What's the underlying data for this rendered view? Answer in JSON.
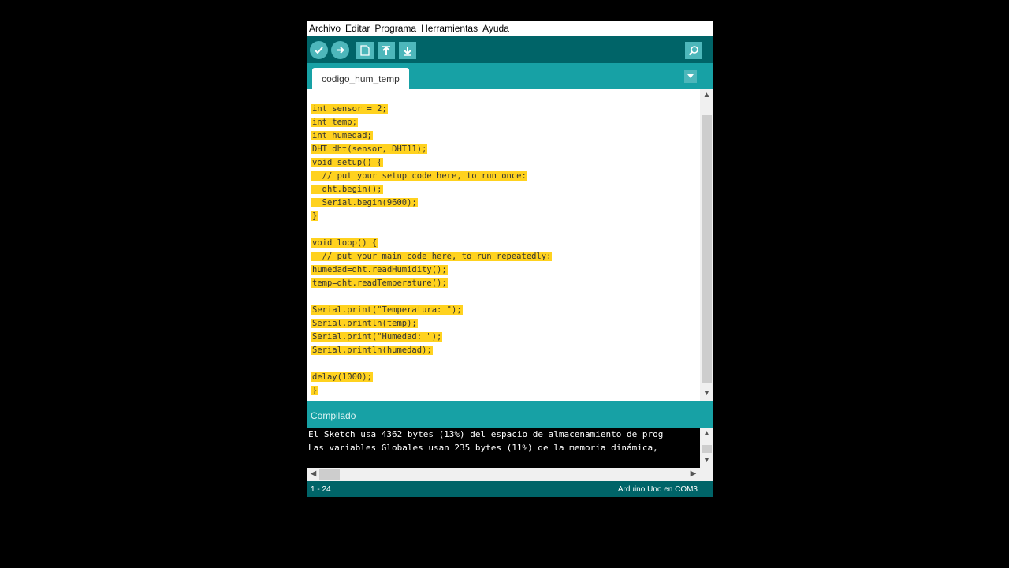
{
  "menu": [
    "Archivo",
    "Editar",
    "Programa",
    "Herramientas",
    "Ayuda"
  ],
  "toolbar": {
    "verify_icon": "check-icon",
    "upload_icon": "arrow-right-icon",
    "new_icon": "new-file-icon",
    "open_icon": "open-up-arrow-icon",
    "save_icon": "save-down-arrow-icon",
    "serial_monitor_icon": "magnifier-icon"
  },
  "tab": {
    "label": "codigo_hum_temp"
  },
  "code": [
    "int sensor = 2;",
    "int temp;",
    "int humedad;",
    "DHT dht(sensor, DHT11);",
    "void setup() {",
    "  // put your setup code here, to run once:",
    "  dht.begin();",
    "  Serial.begin(9600);",
    "}",
    "",
    "void loop() {",
    "  // put your main code here, to run repeatedly:",
    "humedad=dht.readHumidity();",
    "temp=dht.readTemperature();",
    "",
    "Serial.print(\"Temperatura: \");",
    "Serial.println(temp);",
    "Serial.print(\"Humedad: \");",
    "Serial.println(humedad);",
    "",
    "delay(1000);",
    "}"
  ],
  "status": {
    "label": "Compilado"
  },
  "console": [
    "El Sketch usa 4362 bytes (13%) del espacio de almacenamiento de prog",
    "Las variables Globales usan 235 bytes (11%) de la memoria dinámica,"
  ],
  "footer": {
    "line": "1 - 24",
    "board": "Arduino Uno en COM3"
  },
  "colors": {
    "toolbar": "#006468",
    "tabbar": "#17a1a5",
    "highlight": "#ffd21f"
  }
}
